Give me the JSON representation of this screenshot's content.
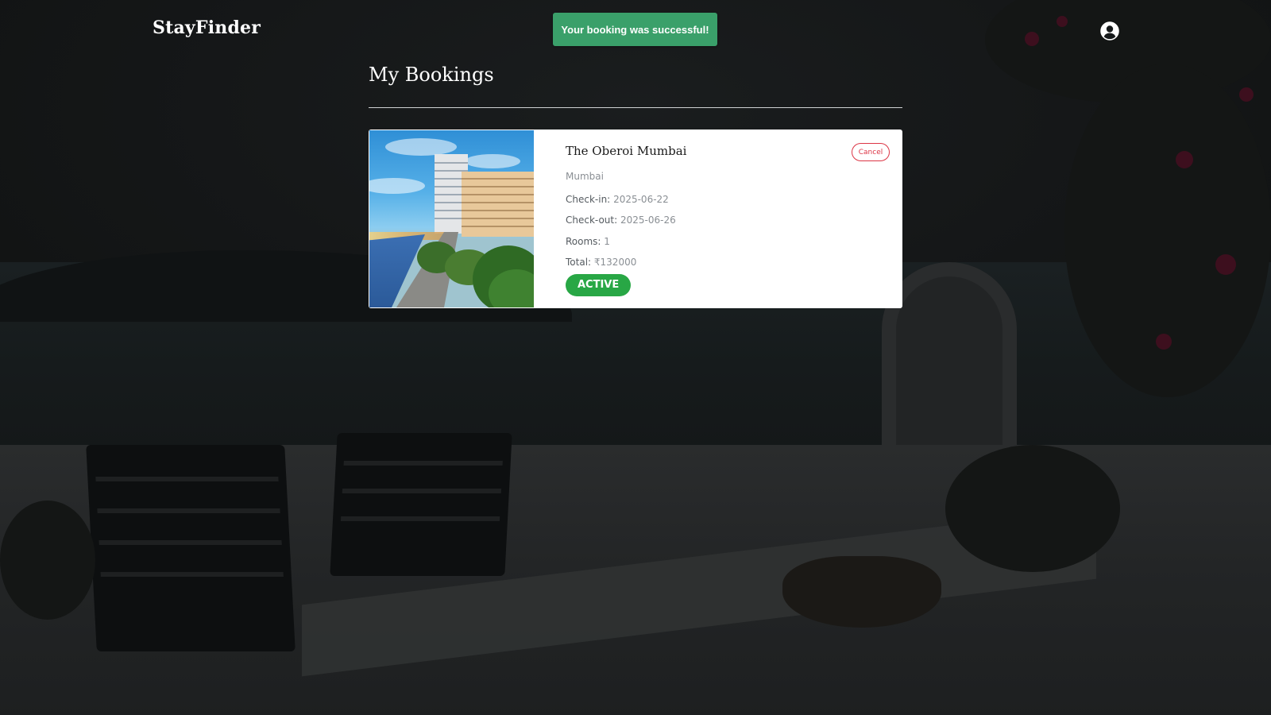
{
  "app": {
    "brand": "StayFinder"
  },
  "toast": {
    "message": "Your booking was successful!",
    "color": "#3aa06a"
  },
  "header": {
    "account_icon": "user-circle-icon"
  },
  "page": {
    "title": "My Bookings"
  },
  "bookings": [
    {
      "hotel_name": "The Oberoi Mumbai",
      "location": "Mumbai",
      "checkin_label": "Check-in:",
      "checkin_value": "2025-06-22",
      "checkout_label": "Check-out:",
      "checkout_value": "2025-06-26",
      "rooms_label": "Rooms:",
      "rooms_value": "1",
      "total_label": "Total:",
      "total_value": "₹132000",
      "status": "ACTIVE",
      "status_color": "#28a745",
      "cancel_label": "Cancel",
      "cancel_color": "#dc3545"
    }
  ]
}
